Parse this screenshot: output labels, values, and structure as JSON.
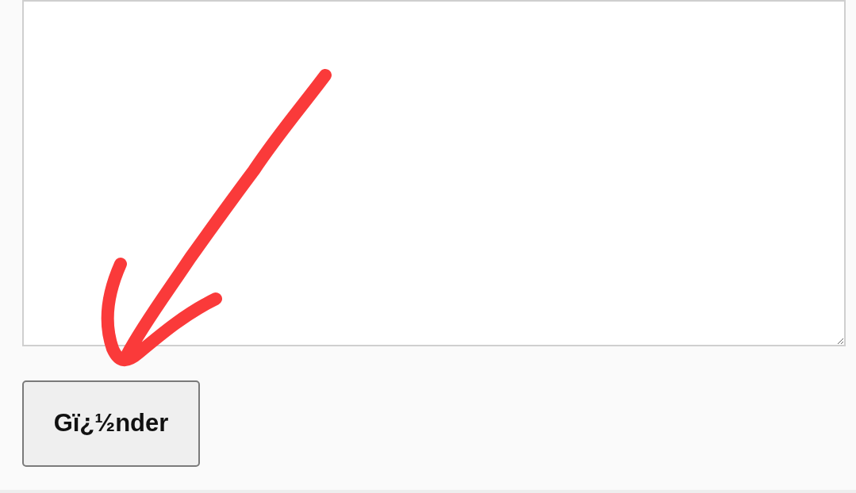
{
  "message_field": {
    "kind": "textarea"
  },
  "submit_button": {
    "label": "Gï¿½nder"
  }
}
